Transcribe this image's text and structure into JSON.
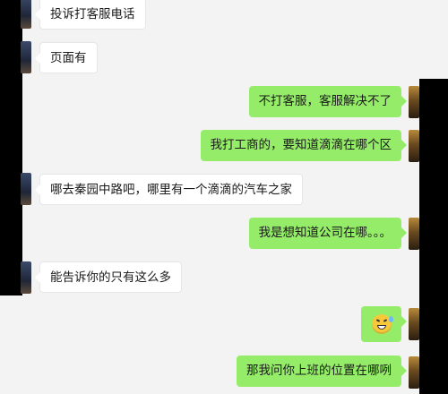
{
  "messages": [
    {
      "side": "left",
      "text": "投诉打客服电话"
    },
    {
      "side": "left",
      "text": "页面有"
    },
    {
      "side": "right",
      "text": "不打客服，客服解决不了"
    },
    {
      "side": "right",
      "text": "我打工商的，要知道滴滴在哪个区"
    },
    {
      "side": "left",
      "text": "哪去秦园中路吧，哪里有一个滴滴的汽车之家"
    },
    {
      "side": "right",
      "text": "我是想知道公司在哪。。。"
    },
    {
      "side": "left",
      "text": "能告诉你的只有这么多"
    },
    {
      "side": "right",
      "emoji": "sweat-smile-emoji"
    },
    {
      "side": "right",
      "text": "那我问你上班的位置在哪咧"
    }
  ],
  "colors": {
    "background": "#f3f3f3",
    "outgoing_bubble": "#95ec69",
    "incoming_bubble": "#ffffff"
  }
}
